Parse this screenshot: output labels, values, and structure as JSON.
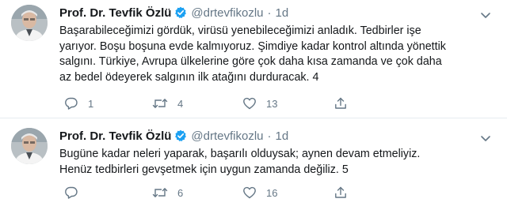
{
  "tweets": [
    {
      "author_name": "Prof. Dr. Tevfik Özlü",
      "handle": "@drtevfikozlu",
      "separator": "·",
      "time": "1d",
      "lines": [
        "Başarabileceğimizi gördük, virüsü yenebileceğimizi anladık. Tedbirler işe",
        "yarıyor. Boşu boşuna evde kalmıyoruz. Şimdiye kadar kontrol altında yönettik",
        "salgını. Türkiye, Avrupa ülkelerine göre çok daha kısa zamanda ve çok daha",
        "az bedel ödeyerek salgının ilk atağını durduracak. 4"
      ],
      "replies": "1",
      "retweets": "4",
      "likes": "13"
    },
    {
      "author_name": "Prof. Dr. Tevfik Özlü",
      "handle": "@drtevfikozlu",
      "separator": "·",
      "time": "1d",
      "lines": [
        "Bugüne kadar neleri yaparak, başarılı olduysak; aynen devam etmeliyiz.",
        "Henüz tedbirleri gevşetmek için uygun zamanda değiliz. 5"
      ],
      "replies": "",
      "retweets": "6",
      "likes": "16"
    }
  ],
  "icons": {
    "verified": "verified-badge-icon",
    "caret": "chevron-down-icon",
    "reply": "reply-icon",
    "retweet": "retweet-icon",
    "like": "heart-icon",
    "share": "share-icon"
  },
  "colors": {
    "text": "#14171a",
    "secondary": "#657786",
    "verified": "#1da1f2",
    "divider": "#e6ecf0"
  }
}
